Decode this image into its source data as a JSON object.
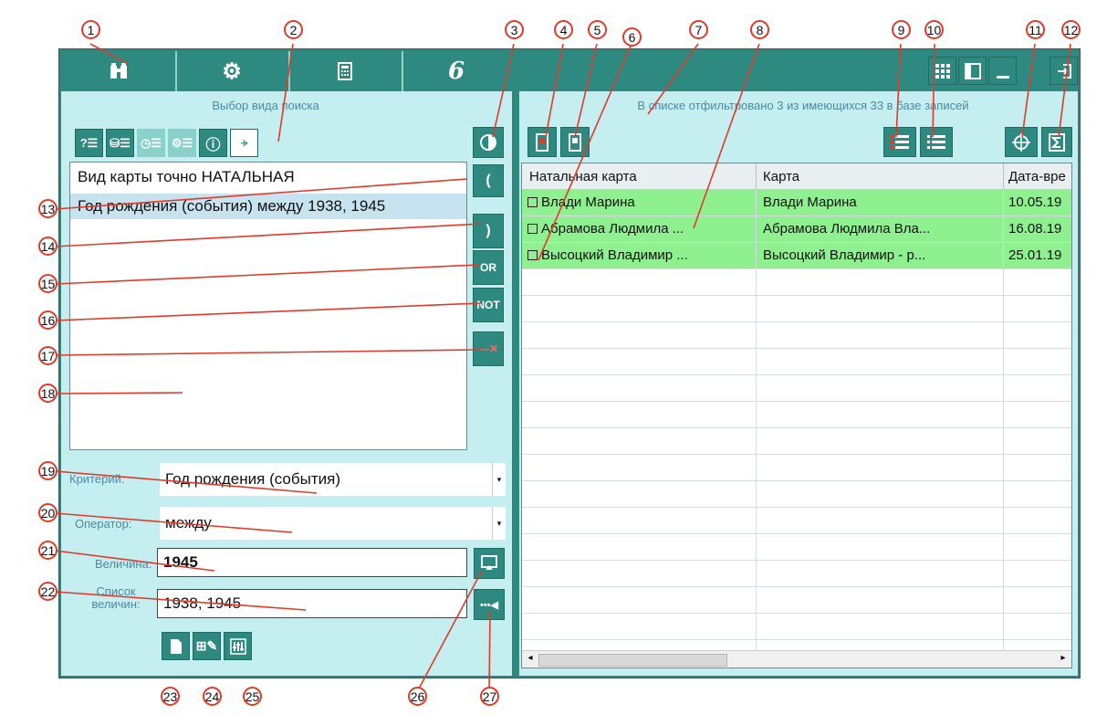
{
  "tabs": [
    {
      "name": "binoculars-icon",
      "glyph": "⍆"
    },
    {
      "name": "gear-icon",
      "glyph": "⚙"
    },
    {
      "name": "calculator-icon",
      "glyph": "▦"
    },
    {
      "name": "script-6-icon",
      "glyph": "6"
    }
  ],
  "left": {
    "header": "Выбор вида поиска",
    "conditions": [
      "Вид карты точно НАТАЛЬНАЯ",
      "Год рождения (события) между 1938, 1945"
    ],
    "side_buttons": [
      "(",
      ")",
      "OR",
      "NOT",
      "—✕"
    ],
    "criterion_label": "Критерий:",
    "criterion_value": "Год рождения (события)",
    "operator_label": "Оператор:",
    "operator_value": "между",
    "value_label": "Величина:",
    "value_value": "1945",
    "list_label": "Список величин:",
    "list_value": "1938, 1945"
  },
  "right": {
    "status": "В списке отфильтровано 3 из имеющихся 33 в базе записей",
    "columns": [
      "Натальная карта",
      "Карта",
      "Дата-вре"
    ],
    "rows": [
      [
        "Влади Марина",
        "Влади Марина",
        "10.05.19"
      ],
      [
        "Абрамова Людмила ...",
        "Абрамова Людмила Вла...",
        "16.08.19"
      ],
      [
        "Высоцкий Владимир ...",
        "Высоцкий Владимир - р...",
        "25.01.19"
      ]
    ]
  },
  "callouts": [
    "1",
    "2",
    "3",
    "4",
    "5",
    "6",
    "7",
    "8",
    "9",
    "10",
    "11",
    "12",
    "13",
    "14",
    "15",
    "16",
    "17",
    "18",
    "19",
    "20",
    "21",
    "22",
    "23",
    "24",
    "25",
    "26",
    "27"
  ],
  "colors": {
    "accent": "#2e8a80",
    "panel": "#c4eef0",
    "row_highlight": "#8ef08e",
    "callout": "#e23a2a"
  }
}
